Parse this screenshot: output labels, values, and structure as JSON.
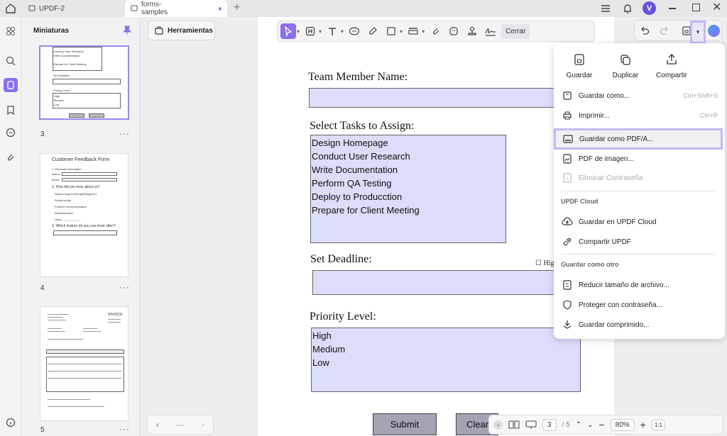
{
  "tabs": [
    {
      "label": "UPDF-2"
    },
    {
      "label": "forms-samples"
    }
  ],
  "user": {
    "avatar_letter": "V"
  },
  "thumbnails": {
    "header": "Miniaturas",
    "pages": [
      {
        "number": "3",
        "more": "···"
      },
      {
        "number": "4",
        "more": "···",
        "title": "Customer Feedback Form"
      },
      {
        "number": "5",
        "more": "···",
        "title": "INVOICE"
      }
    ],
    "page3_lines": [
      "Conduct User Research",
      "Write Documentation",
      "Prepare for Client Meeting",
      "Set Deadline",
      "Priority Level",
      "High",
      "Medium",
      "Low"
    ],
    "page4_lines": [
      "1. Personal Information",
      "Name:",
      "Email:",
      "2. How did you hear about us?",
      "Search engine (Google/Bing/etc.)",
      "Social media",
      "Friend's recommendation",
      "Advertisement",
      "Other: ___________",
      "3. Which feature do you use most often?"
    ]
  },
  "tools_button": "Herramientas",
  "toolbar": {
    "close_label": "Cerrar"
  },
  "form": {
    "member_label": "Team Member Name:",
    "tasks_label": "Select Tasks to Assign:",
    "tasks": [
      "Design Homepage",
      "Conduct User Research",
      "Write Documentation",
      "Perform QA Testing",
      "Deploy to Producction",
      "Prepare for Client Meeting"
    ],
    "deadline_label": "Set Deadline:",
    "high_checkbox": "☐ High",
    "priority_label": "Priority Level:",
    "priorities": [
      "High",
      "Medium",
      "Low"
    ],
    "submit": "Submit",
    "clear": "Clear"
  },
  "menu": {
    "quick": [
      {
        "label": "Guardar",
        "icon": "save-icon"
      },
      {
        "label": "Duplicar",
        "icon": "duplicate-icon"
      },
      {
        "label": "Compartir",
        "icon": "share-icon"
      }
    ],
    "save_as": {
      "label": "Guardar como...",
      "shortcut": "Ctrl+Shift+S"
    },
    "print": {
      "label": "Imprimir...",
      "shortcut": "Ctrl+P"
    },
    "save_pdfa": {
      "label": "Guardar como PDF/A..."
    },
    "pdf_image": {
      "label": "PDF de imagen..."
    },
    "remove_password": {
      "label": "Eliminar Contraseña"
    },
    "cloud_section": "UPDF Cloud",
    "save_cloud": {
      "label": "Guardar en UPDF Cloud"
    },
    "share_updf": {
      "label": "Compartir UPDF"
    },
    "other_section": "Guardar como otro",
    "reduce": {
      "label": "Reducir tamaño de archivo..."
    },
    "protect": {
      "label": "Proteger con contraseña..."
    },
    "compressed": {
      "label": "Guardar comprimido..."
    }
  },
  "pager": {
    "current": "3",
    "total": "/ 5",
    "zoom": "80%",
    "fit": "1:1",
    "more": "···"
  },
  "colors": {
    "accent": "#8b6ff0",
    "field_fill": "#dcdcfb",
    "highlight": "#c5b7f4"
  }
}
